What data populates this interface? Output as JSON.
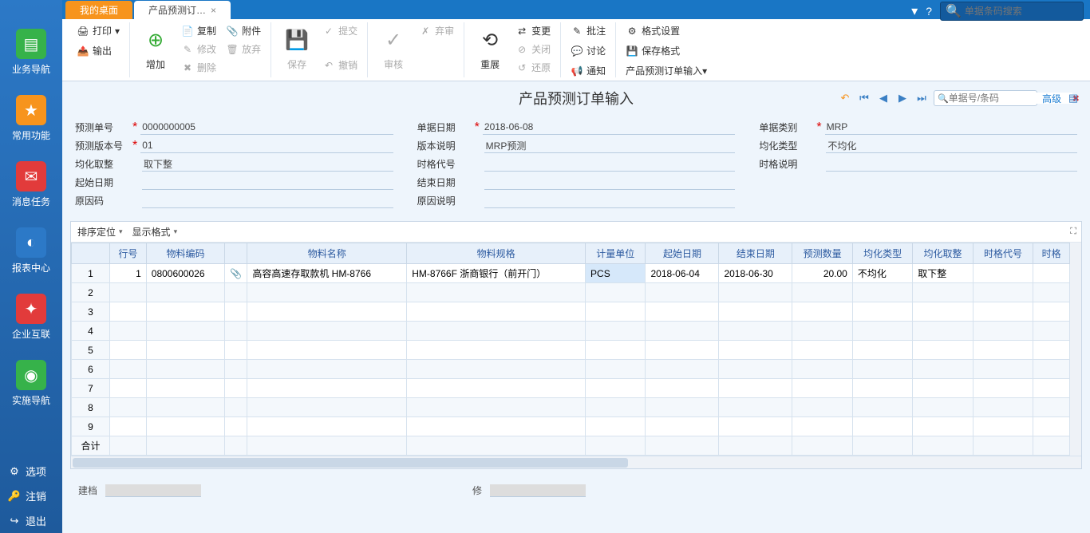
{
  "nav": {
    "items": [
      {
        "label": "业务导航",
        "color": "#36b24a",
        "glyph": "▤"
      },
      {
        "label": "常用功能",
        "color": "#f7941d",
        "glyph": "★"
      },
      {
        "label": "消息任务",
        "color": "#e23b3b",
        "glyph": "✉"
      },
      {
        "label": "报表中心",
        "color": "#2c79c7",
        "glyph": "◐"
      },
      {
        "label": "企业互联",
        "color": "#e23b3b",
        "glyph": "✦"
      },
      {
        "label": "实施导航",
        "color": "#36b24a",
        "glyph": "◉"
      }
    ],
    "links": {
      "options": "选项",
      "logout": "注销",
      "exit": "退出"
    }
  },
  "tabs": {
    "home": "我的桌面",
    "active": "产品预测订…",
    "search_ph": "单据条码搜索"
  },
  "ribbon": {
    "print": "打印",
    "export": "输出",
    "add": "增加",
    "copy": "复制",
    "edit": "修改",
    "delete": "删除",
    "attach": "附件",
    "discard": "放弃",
    "save": "保存",
    "submit": "提交",
    "revoke": "撤销",
    "audit": "审核",
    "reject": "弃审",
    "refresh": "重展",
    "change": "变更",
    "close": "关闭",
    "restore": "还原",
    "bulk": "批注",
    "discuss": "讨论",
    "notify": "通知",
    "fmt_set": "格式设置",
    "fmt_save": "保存格式",
    "fmt_order": "产品预测订单输入▾"
  },
  "page": {
    "title": "产品预测订单输入",
    "search_ph": "单据号/条码",
    "adv": "高级"
  },
  "form": {
    "labels": {
      "order_no": "预测单号",
      "order_date": "单据日期",
      "order_type": "单据类别",
      "version": "预测版本号",
      "version_desc": "版本说明",
      "avg_type": "均化类型",
      "avg_round": "均化取整",
      "slot_code": "时格代号",
      "slot_desc": "时格说明",
      "start": "起始日期",
      "end": "结束日期",
      "reason": "原因码",
      "reason_desc": "原因说明"
    },
    "values": {
      "order_no": "0000000005",
      "order_date": "2018-06-08",
      "order_type": "MRP",
      "version": "01",
      "version_desc": "MRP预测",
      "avg_type": "不均化",
      "avg_round": "取下整",
      "slot_code": "",
      "slot_desc": "",
      "start": "",
      "end": "",
      "reason": "",
      "reason_desc": ""
    }
  },
  "grid_tb": {
    "sort": "排序定位",
    "format": "显示格式"
  },
  "grid": {
    "headers": [
      "行号",
      "物料编码",
      "",
      "物料名称",
      "物料规格",
      "计量单位",
      "起始日期",
      "结束日期",
      "预测数量",
      "均化类型",
      "均化取整",
      "时格代号",
      "时格"
    ],
    "row1": {
      "line": "1",
      "code": "0800600026",
      "name": "高容高速存取款机 HM-8766",
      "spec": "HM-8766F 浙商银行（前开门）",
      "unit": "PCS",
      "start": "2018-06-04",
      "end": "2018-06-30",
      "qty": "20.00",
      "avg_type": "不均化",
      "avg_round": "取下整"
    },
    "sum": "合计"
  },
  "footer": {
    "creator": "建档",
    "editor": "修"
  }
}
